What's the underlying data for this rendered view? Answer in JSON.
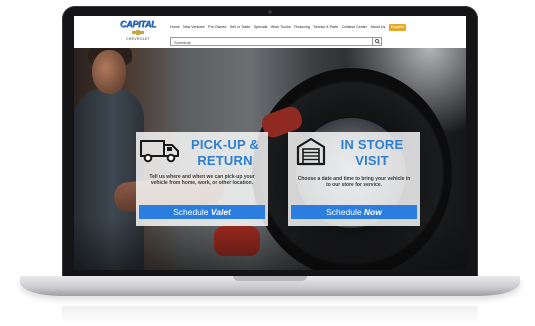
{
  "logo": {
    "wordmark": "CAPITAL",
    "sub": "CHEVROLET"
  },
  "nav": {
    "items": [
      "Home",
      "New Vehicles",
      "Pre-Owned",
      "Sell or Trade",
      "Specials",
      "Work Trucks",
      "Financing",
      "Service & Parts",
      "Collision Center",
      "About Us"
    ],
    "cta": "Espanol"
  },
  "search": {
    "placeholder": "Schedule"
  },
  "cards": {
    "valet": {
      "title_line1": "PICK-UP &",
      "title_line2": "RETURN",
      "description": "Tell us where and when we can pick-up your vehicle from home, work, or other location.",
      "button_prefix": "Schedule ",
      "button_emphasis": "Valet"
    },
    "visit": {
      "title_line1": "IN STORE",
      "title_line2": "VISIT",
      "description": "Choose a date and time to bring your vehicle in to our store for service.",
      "button_prefix": "Schedule ",
      "button_emphasis": "Now"
    }
  },
  "colors": {
    "accent_blue": "#2f7fd0",
    "button_blue": "#2b7de0",
    "cta_gold": "#e2a82b"
  },
  "icons": {
    "valet": "truck-icon",
    "visit": "garage-icon",
    "search": "search-icon"
  }
}
